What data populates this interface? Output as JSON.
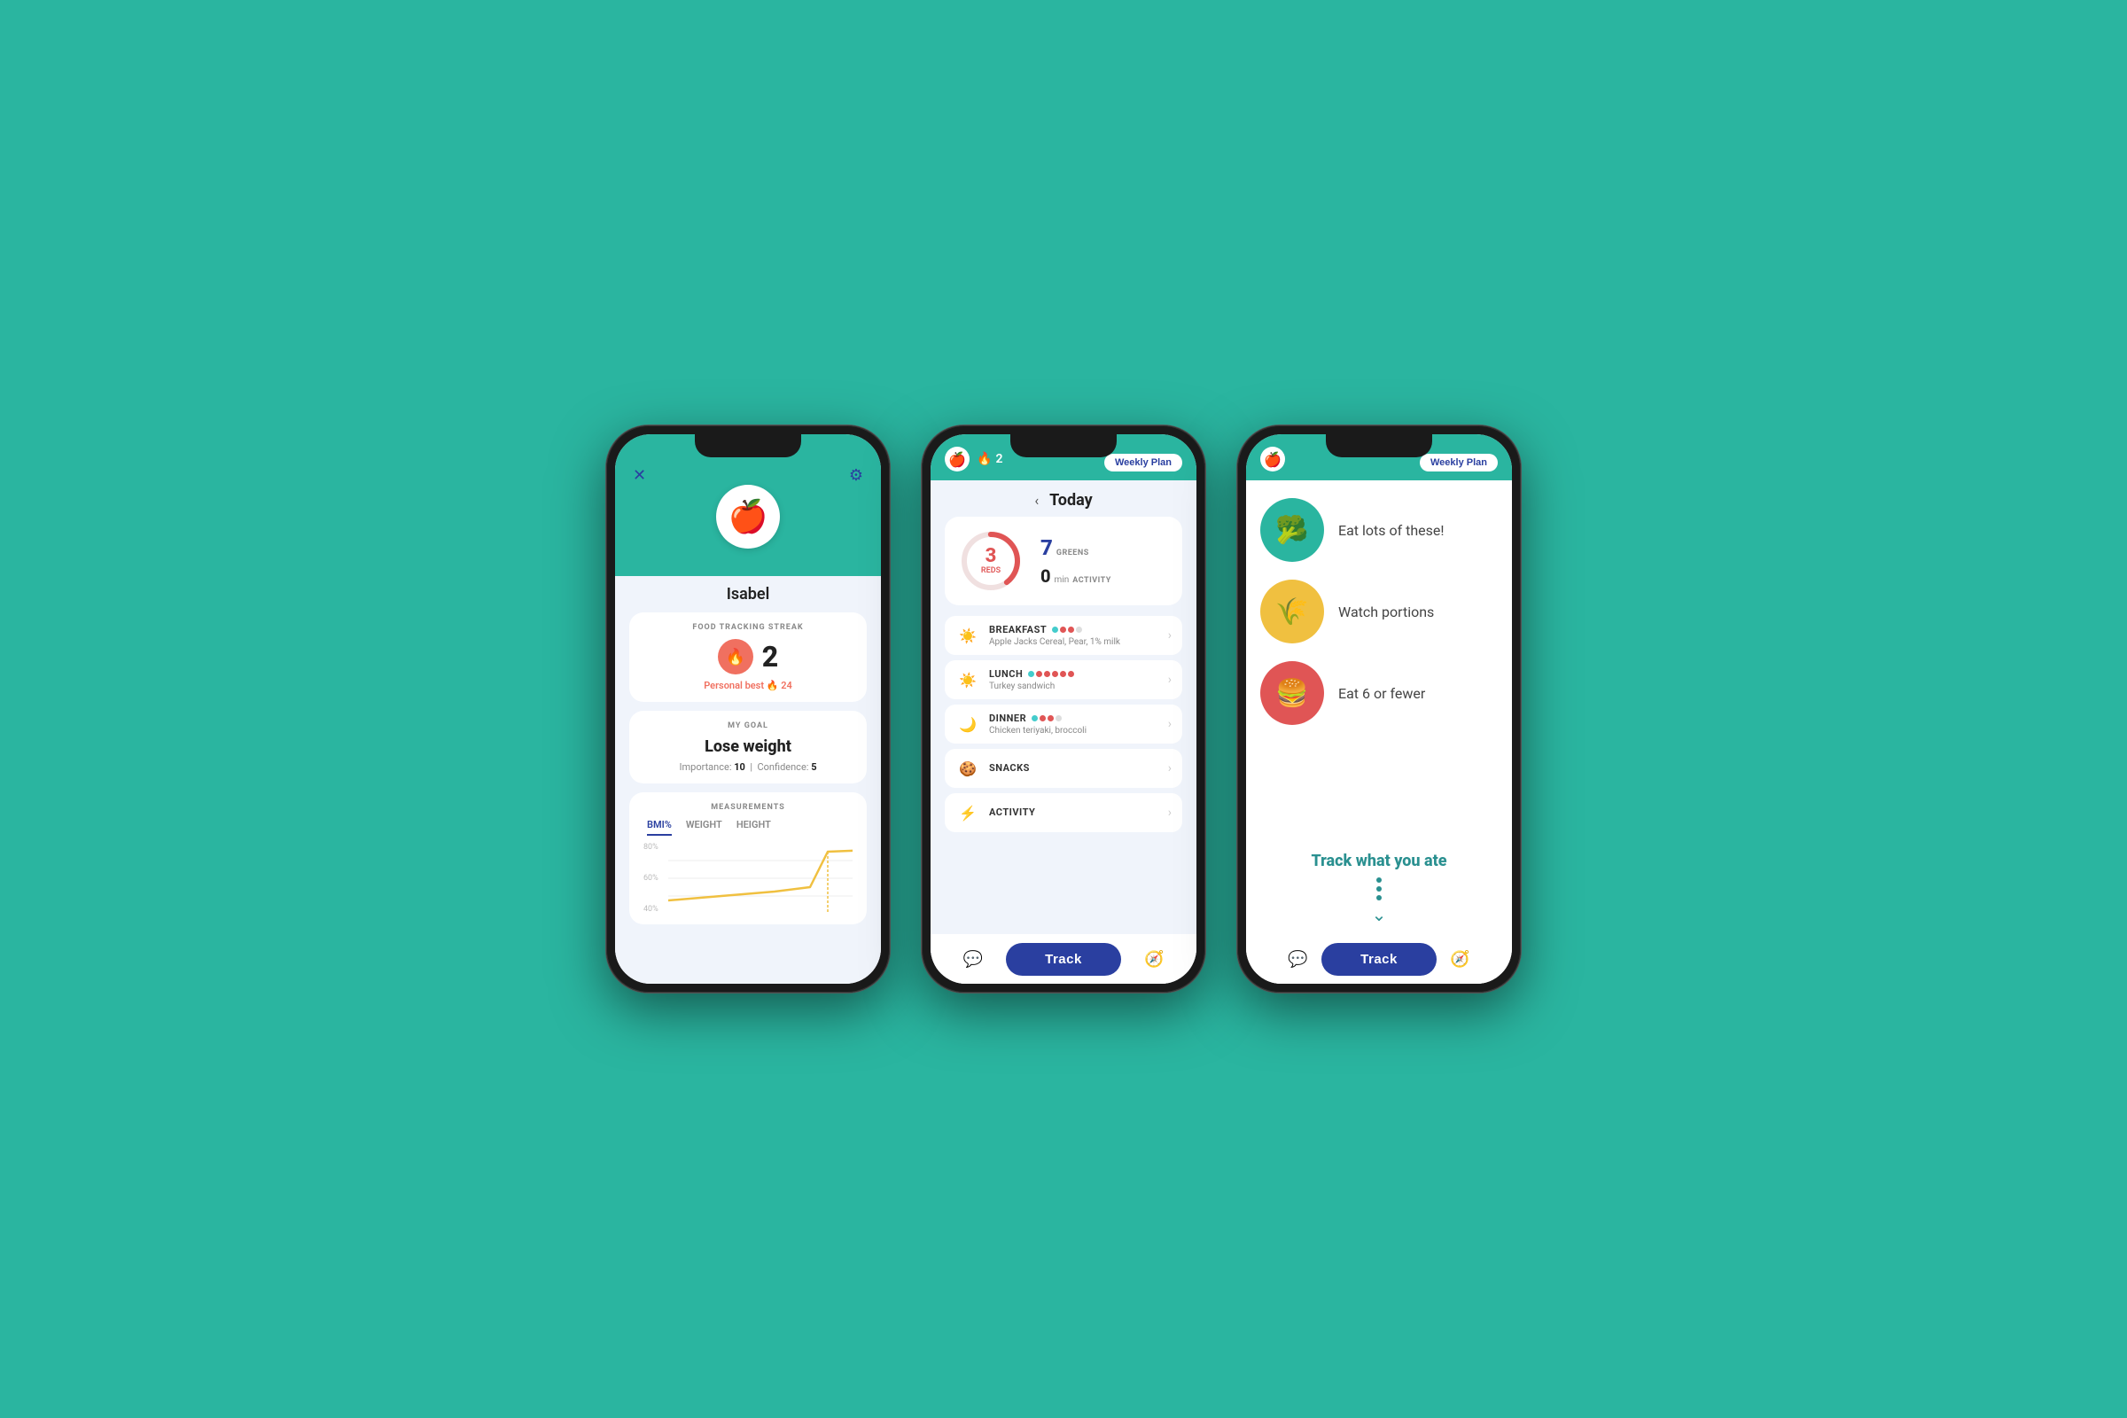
{
  "background_color": "#2ab5a0",
  "phone1": {
    "user_name": "Isabel",
    "streak_label": "FOOD TRACKING STREAK",
    "streak_count": "2",
    "personal_best_label": "Personal best",
    "personal_best_value": "24",
    "goal_label": "MY GOAL",
    "goal_title": "Lose weight",
    "importance_label": "Importance:",
    "importance_value": "10",
    "confidence_label": "Confidence:",
    "confidence_value": "5",
    "measurements_label": "MEASUREMENTS",
    "tabs": [
      "BMI%",
      "WEIGHT",
      "HEIGHT"
    ],
    "active_tab": "BMI%",
    "chart_labels": [
      "80%",
      "60%",
      "40%"
    ]
  },
  "phone2": {
    "streak_count": "2",
    "weekly_plan_label": "Weekly Plan",
    "today_label": "Today",
    "reds_count": "3",
    "reds_label": "REDS",
    "greens_count": "7",
    "greens_label": "GREENS",
    "activity_count": "0",
    "activity_unit": "min",
    "activity_label": "ACTIVITY",
    "meals": [
      {
        "name": "BREAKFAST",
        "detail": "Apple Jacks Cereal, Pear, 1% milk",
        "dots": [
          "green",
          "red",
          "red",
          "empty"
        ]
      },
      {
        "name": "LUNCH",
        "detail": "Turkey sandwich",
        "dots": [
          "green",
          "red",
          "red",
          "red",
          "red",
          "red"
        ]
      },
      {
        "name": "DINNER",
        "detail": "Chicken teriyaki, broccoli",
        "dots": [
          "green",
          "red",
          "red",
          "empty"
        ]
      },
      {
        "name": "SNACKS",
        "detail": "",
        "dots": []
      },
      {
        "name": "ACTIVITY",
        "detail": "",
        "dots": []
      }
    ],
    "track_label": "Track"
  },
  "phone3": {
    "weekly_plan_label": "Weekly Plan",
    "guide_items": [
      {
        "icon": "🥦",
        "color": "green",
        "text": "Eat lots of these!"
      },
      {
        "icon": "🌾",
        "color": "yellow",
        "text": "Watch portions"
      },
      {
        "icon": "🍔",
        "color": "red",
        "text": "Eat 6 or fewer"
      }
    ],
    "cta_title": "Track what you ate",
    "track_label": "Track"
  }
}
